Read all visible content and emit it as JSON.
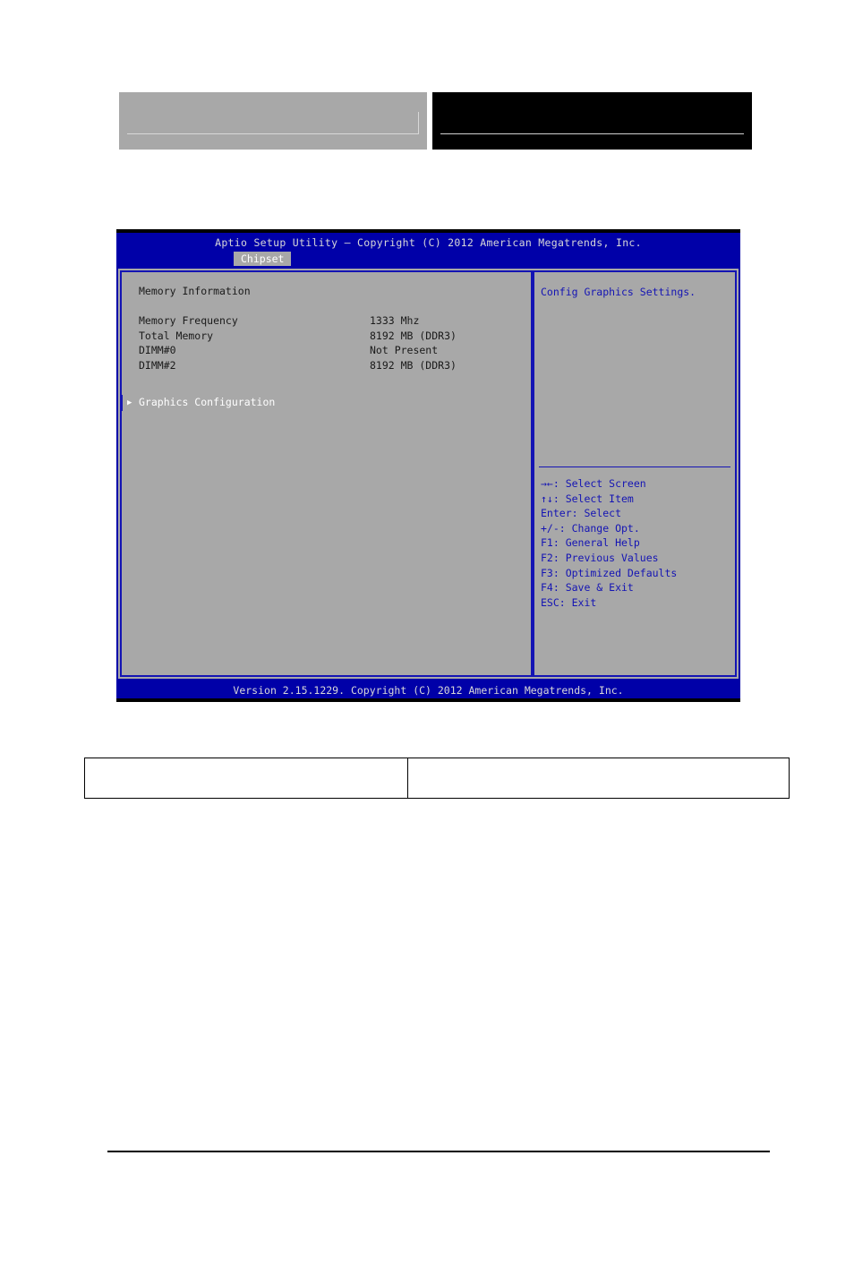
{
  "top_boxes": {
    "left": {
      "name": "blank-grey-box"
    },
    "right": {
      "name": "blank-black-box"
    }
  },
  "bios": {
    "title": "Aptio Setup Utility – Copyright (C) 2012 American Megatrends, Inc.",
    "tab": "Chipset",
    "left_panel": {
      "heading": "Memory Information",
      "rows": [
        {
          "label": "Memory Frequency",
          "value": "1333 Mhz"
        },
        {
          "label": "Total Memory",
          "value": "8192 MB (DDR3)"
        },
        {
          "label": "DIMM#0",
          "value": "Not Present"
        },
        {
          "label": "DIMM#2",
          "value": "8192 MB (DDR3)"
        }
      ],
      "menu_items": [
        {
          "arrow": "▶",
          "label": "Graphics Configuration",
          "selected": true
        }
      ]
    },
    "right_panel": {
      "help": "Config Graphics Settings.",
      "key_legend": [
        "→←: Select Screen",
        "↑↓: Select Item",
        "Enter: Select",
        "+/-: Change Opt.",
        "F1: General Help",
        "F2: Previous Values",
        "F3: Optimized Defaults",
        "F4: Save & Exit",
        "ESC: Exit"
      ]
    },
    "footer": "Version 2.15.1229. Copyright (C) 2012 American Megatrends, Inc.",
    "colors": {
      "background_blue": "#0000a8",
      "panel_grey": "#a8a8a8",
      "border_blue": "#1414b4",
      "text_dark": "#1a1a1a",
      "text_light": "#d8d8d8",
      "selected_text": "#ffffff"
    }
  },
  "caption_table": {
    "cells": [
      "",
      ""
    ]
  }
}
